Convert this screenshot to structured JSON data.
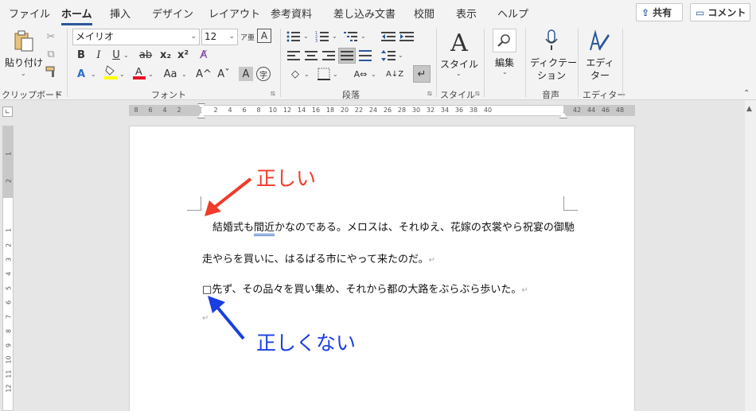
{
  "tabs": [
    "ファイル",
    "ホーム",
    "挿入",
    "デザイン",
    "レイアウト",
    "参考資料",
    "差し込み文書",
    "校閲",
    "表示",
    "ヘルプ"
  ],
  "share": {
    "icon": "share-icon",
    "label": "共有"
  },
  "comment": {
    "icon": "comment-icon",
    "label": "コメント"
  },
  "clipboard": {
    "paste_label": "貼り付け",
    "group_label": "クリップボード"
  },
  "font": {
    "name": "メイリオ",
    "size": "12",
    "group_label": "フォント",
    "bold": "B",
    "italic": "I",
    "underline": "U",
    "strike": "ab",
    "subscript": "x₂",
    "superscript": "x²",
    "change_case": "Aa",
    "grow": "A^",
    "shrink": "Aˇ",
    "char_shade": "A",
    "enclosed": "字",
    "highlight_color": "#ffff00",
    "font_color": "#e81123"
  },
  "paragraph": {
    "group_label": "段落"
  },
  "styles": {
    "label": "スタイル",
    "group_label": "スタイル"
  },
  "editing": {
    "label": "編集"
  },
  "voice": {
    "label_line1": "ディクテー",
    "label_line2": "ション",
    "group_label": "音声"
  },
  "editor": {
    "label_line1": "エディ",
    "label_line2": "ター",
    "group_label": "エディター"
  },
  "ruler_ticks": [
    "8",
    "6",
    "4",
    "2",
    "2",
    "4",
    "6",
    "8",
    "10",
    "12",
    "14",
    "16",
    "18",
    "20",
    "22",
    "24",
    "26",
    "28",
    "30",
    "32",
    "34",
    "36",
    "38",
    "40",
    "42",
    "44",
    "46",
    "48"
  ],
  "vruler_ticks": [
    "1",
    "2",
    "1",
    "2",
    "3",
    "4",
    "5",
    "6",
    "7",
    "8",
    "9",
    "10",
    "11",
    "12"
  ],
  "document": {
    "line1_pre": "結婚式も",
    "line1_squig": "間近",
    "line1_post": "かなのである。メロスは、それゆえ、花嫁の衣裳やら祝宴の御馳",
    "line2": "走やらを買いに、はるばる市にやって来たのだ。",
    "line3_box": "□",
    "line3": "先ず、その品々を買い集め、それから都の大路をぶらぶら歩いた。",
    "para_mark": "↵"
  },
  "annotations": {
    "correct": "正しい",
    "incorrect": "正しくない",
    "correct_color": "#f03c28",
    "incorrect_color": "#1a3fe0"
  }
}
